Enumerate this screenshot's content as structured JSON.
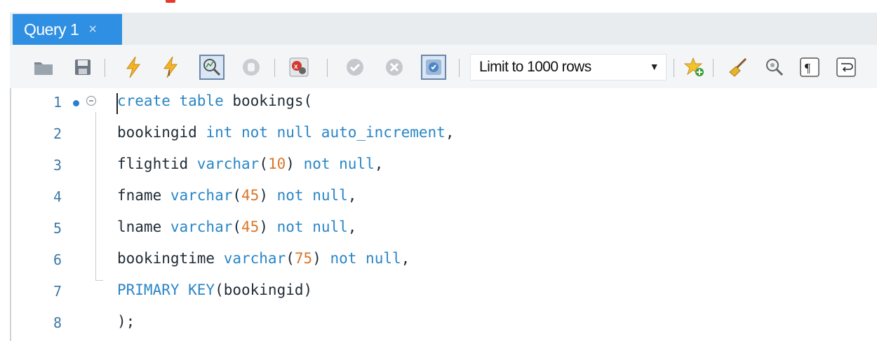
{
  "tab": {
    "title": "Query 1",
    "close": "×"
  },
  "toolbar": {
    "limit_select": "Limit to 1000 rows",
    "icons": [
      "open-folder-icon",
      "save-icon",
      "execute-icon",
      "execute-current-icon",
      "explain-icon",
      "stop-icon",
      "toggle-error-stop-icon",
      "commit-icon",
      "rollback-icon",
      "autocommit-icon",
      "bookmark-icon",
      "beautify-icon",
      "find-icon",
      "invisible-chars-icon",
      "word-wrap-icon"
    ]
  },
  "editor": {
    "lines": [
      {
        "no": "1",
        "tokens": [
          {
            "t": "create table ",
            "k": "kw"
          },
          {
            "t": "bookings(",
            "k": "id"
          }
        ]
      },
      {
        "no": "2",
        "tokens": [
          {
            "t": "bookingid ",
            "k": "id"
          },
          {
            "t": "int not null auto_increment",
            "k": "kw"
          },
          {
            "t": ",",
            "k": "id"
          }
        ]
      },
      {
        "no": "3",
        "tokens": [
          {
            "t": "flightid ",
            "k": "id"
          },
          {
            "t": "varchar",
            "k": "kw"
          },
          {
            "t": "(",
            "k": "id"
          },
          {
            "t": "10",
            "k": "num"
          },
          {
            "t": ") ",
            "k": "id"
          },
          {
            "t": "not null",
            "k": "kw"
          },
          {
            "t": ",",
            "k": "id"
          }
        ]
      },
      {
        "no": "4",
        "tokens": [
          {
            "t": "fname ",
            "k": "id"
          },
          {
            "t": "varchar",
            "k": "kw"
          },
          {
            "t": "(",
            "k": "id"
          },
          {
            "t": "45",
            "k": "num"
          },
          {
            "t": ") ",
            "k": "id"
          },
          {
            "t": "not null",
            "k": "kw"
          },
          {
            "t": ",",
            "k": "id"
          }
        ]
      },
      {
        "no": "5",
        "tokens": [
          {
            "t": "lname ",
            "k": "id"
          },
          {
            "t": "varchar",
            "k": "kw"
          },
          {
            "t": "(",
            "k": "id"
          },
          {
            "t": "45",
            "k": "num"
          },
          {
            "t": ") ",
            "k": "id"
          },
          {
            "t": "not null",
            "k": "kw"
          },
          {
            "t": ",",
            "k": "id"
          }
        ]
      },
      {
        "no": "6",
        "tokens": [
          {
            "t": "bookingtime ",
            "k": "id"
          },
          {
            "t": "varchar",
            "k": "kw"
          },
          {
            "t": "(",
            "k": "id"
          },
          {
            "t": "75",
            "k": "num"
          },
          {
            "t": ") ",
            "k": "id"
          },
          {
            "t": "not null",
            "k": "kw"
          },
          {
            "t": ",",
            "k": "id"
          }
        ]
      },
      {
        "no": "7",
        "tokens": [
          {
            "t": "PRIMARY KEY",
            "k": "kw"
          },
          {
            "t": "(bookingid)",
            "k": "id"
          }
        ]
      },
      {
        "no": "8",
        "tokens": [
          {
            "t": ");",
            "k": "id"
          }
        ]
      }
    ]
  },
  "colors": {
    "tab_active": "#2f8fe3",
    "keyword": "#2a86c6",
    "number": "#d9772a",
    "line_number": "#3e7aa8"
  }
}
